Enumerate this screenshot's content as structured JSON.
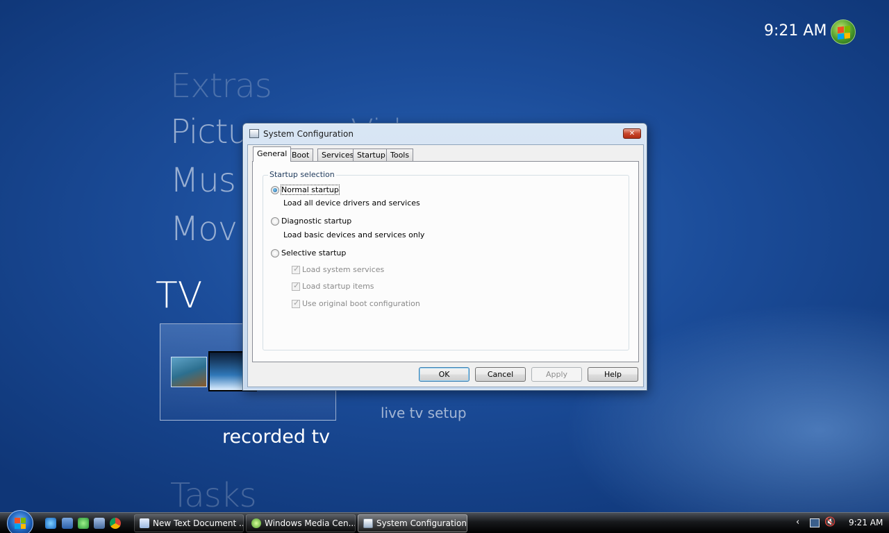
{
  "media_center": {
    "clock": "9:21 AM",
    "menu": {
      "extras": "Extras",
      "pictures": "Pictu",
      "videos_ghost": "Vid",
      "music": "Mus",
      "movies": "Mov",
      "tv": "TV",
      "tasks": "Tasks"
    },
    "tv_strip": {
      "recorded": "recorded tv",
      "live_setup": "live tv setup"
    }
  },
  "dialog": {
    "title": "System Configuration",
    "close_icon": "close-icon",
    "tabs": [
      {
        "label": "General",
        "active": true
      },
      {
        "label": "Boot",
        "active": false
      },
      {
        "label": "Services",
        "active": false
      },
      {
        "label": "Startup",
        "active": false
      },
      {
        "label": "Tools",
        "active": false
      }
    ],
    "group_title": "Startup selection",
    "options": {
      "normal": {
        "label": "Normal startup",
        "desc": "Load all device drivers and services",
        "checked": true
      },
      "diagnostic": {
        "label": "Diagnostic startup",
        "desc": "Load basic devices and services only",
        "checked": false
      },
      "selective": {
        "label": "Selective startup",
        "checked": false
      }
    },
    "selective_items": [
      {
        "label": "Load system services",
        "checked": true,
        "enabled": false
      },
      {
        "label": "Load startup items",
        "checked": true,
        "enabled": false
      },
      {
        "label": "Use original boot configuration",
        "checked": true,
        "enabled": false
      }
    ],
    "buttons": {
      "ok": "OK",
      "cancel": "Cancel",
      "apply": "Apply",
      "help": "Help"
    }
  },
  "taskbar": {
    "tasks": [
      {
        "label": "New Text Document ..."
      },
      {
        "label": "Windows Media Cen..."
      },
      {
        "label": "System Configuration"
      }
    ],
    "tray_arrow": "‹",
    "volume_icon": "🔇",
    "clock": "9:21 AM"
  },
  "colors": {
    "accent": "#1b4c99",
    "dialog_frame": "#c7d9ee",
    "close_button": "#c8462b"
  }
}
